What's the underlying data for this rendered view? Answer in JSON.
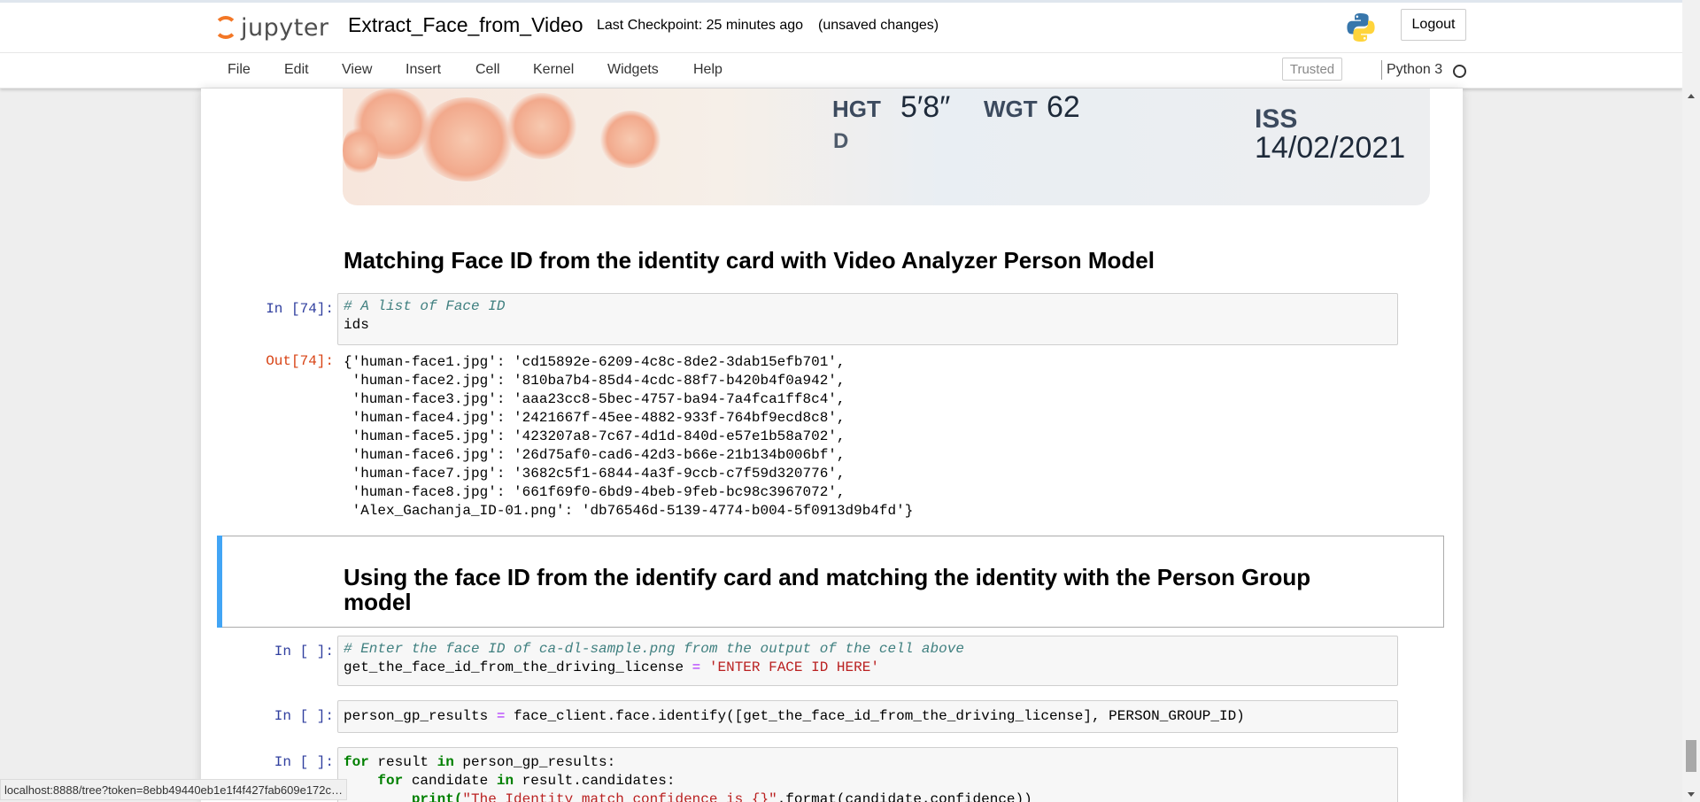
{
  "header": {
    "logo_text": "jupyter",
    "notebook_name": "Extract_Face_from_Video",
    "checkpoint": "Last Checkpoint: 25 minutes ago",
    "autosave_status": "(unsaved changes)",
    "logout_label": "Logout"
  },
  "menubar": {
    "items": [
      "File",
      "Edit",
      "View",
      "Insert",
      "Cell",
      "Kernel",
      "Widgets",
      "Help"
    ],
    "trusted_label": "Trusted",
    "kernel_name": "Python 3"
  },
  "id_card": {
    "hgt_label": "HGT",
    "hgt_value": "5′8″",
    "wgt_label": "WGT",
    "wgt_value": "62",
    "d_label": "D",
    "iss_label": "ISS",
    "iss_value": "14/02/2021"
  },
  "cells": {
    "heading1": "Matching Face ID from the identity card with Video Analyzer Person Model",
    "cell74": {
      "in_prompt": "In [74]:",
      "comment": "# A list of Face ID",
      "code": "ids",
      "out_prompt": "Out[74]:",
      "output_lines": [
        "{'human-face1.jpg': 'cd15892e-6209-4c8c-8de2-3dab15efb701',",
        " 'human-face2.jpg': '810ba7b4-85d4-4cdc-88f7-b420b4f0a942',",
        " 'human-face3.jpg': 'aaa23cc8-5bec-4757-ba94-7a4fca1ff8c4',",
        " 'human-face4.jpg': '2421667f-45ee-4882-933f-764bf9ecd8c8',",
        " 'human-face5.jpg': '423207a8-7c67-4d1d-840d-e57e1b58a702',",
        " 'human-face6.jpg': '26d75af0-cad6-42d3-b66e-21b134b006bf',",
        " 'human-face7.jpg': '3682c5f1-6844-4a3f-9ccb-c7f59d320776',",
        " 'human-face8.jpg': '661f69f0-6bd9-4beb-9feb-bc98c3967072',",
        " 'Alex_Gachanja_ID-01.png': 'db76546d-5139-4774-b004-5f0913d9b4fd'}"
      ]
    },
    "heading2_line1": "Using the face ID from the identify card and matching the identity with the Person Group",
    "heading2_line2": "model",
    "cell_a": {
      "in_prompt": "In [ ]:",
      "comment": "# Enter the face ID of ca-dl-sample.png from the output of the cell above",
      "var": "get_the_face_id_from_the_driving_license ",
      "op": "=",
      "str": "'ENTER FACE ID HERE'"
    },
    "cell_b": {
      "in_prompt": "In [ ]:",
      "var": "person_gp_results ",
      "op": "=",
      "rest": " face_client.face.identify([get_the_face_id_from_the_driving_license], PERSON_GROUP_ID)"
    },
    "cell_c": {
      "in_prompt": "In [ ]:",
      "kw_for": "for",
      "line1_mid": " result ",
      "kw_in": "in",
      "line1_end": " person_gp_results:",
      "line2_indent": "    ",
      "line2_mid": " candidate ",
      "line2_end": " result.candidates:",
      "line3_indent": "        ",
      "line3_fn": "print(",
      "line3_str": "\"The Identity match confidence is {}\"",
      "line3_end": ".format(candidate.confidence))"
    }
  },
  "status_bar_url": "localhost:8888/tree?token=8ebb49440eb1e1f4f427fab609e172c…",
  "colors": {
    "selected_cell_bar": "#42a5f5",
    "in_prompt": "#303f9f",
    "out_prompt": "#d84315",
    "jupyter_orange": "#f37726"
  }
}
